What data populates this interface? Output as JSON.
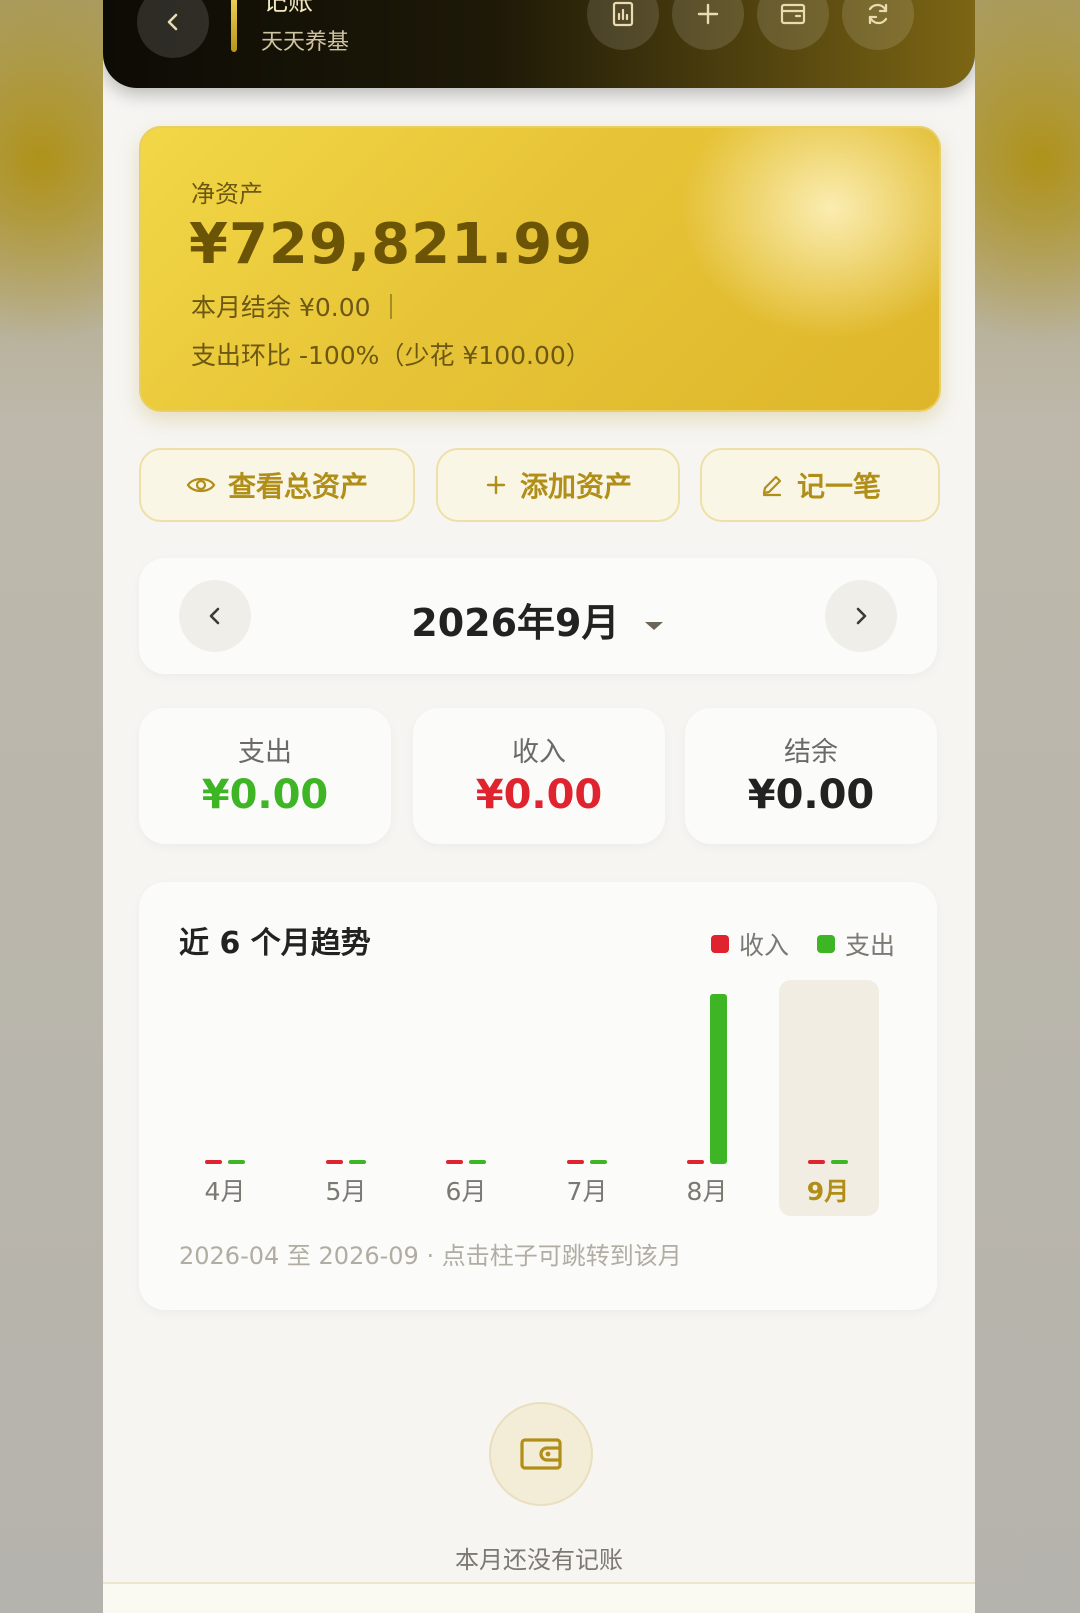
{
  "header": {
    "title": "记账",
    "subtitle": "天天养基"
  },
  "net_assets": {
    "label": "净资产",
    "value": "¥729,821.99",
    "month_balance": "本月结余 ¥0.00 ｜",
    "expense_compare": "支出环比 -100%（少花 ¥100.00）"
  },
  "actions": {
    "view_total": "查看总资产",
    "add_asset": "添加资产",
    "record": "记一笔"
  },
  "month_selector": {
    "current": "2026年9月"
  },
  "stats": {
    "expense": {
      "label": "支出",
      "value": "¥0.00",
      "color": "#3eb524"
    },
    "income": {
      "label": "收入",
      "value": "¥0.00",
      "color": "#e0242f"
    },
    "balance": {
      "label": "结余",
      "value": "¥0.00",
      "color": "#222222"
    }
  },
  "trend": {
    "title": "近 6 个月趋势",
    "legend_income": "收入",
    "legend_expense": "支出",
    "footnote": "2026-04 至 2026-09 · 点击柱子可跳转到该月",
    "selected": "9月"
  },
  "chart_data": {
    "type": "bar",
    "title": "近 6 个月趋势",
    "categories": [
      "4月",
      "5月",
      "6月",
      "7月",
      "8月",
      "9月"
    ],
    "series": [
      {
        "name": "收入",
        "color": "#e0242f",
        "values": [
          0,
          0,
          0,
          0,
          0,
          0
        ]
      },
      {
        "name": "支出",
        "color": "#3eb524",
        "values": [
          0,
          0,
          0,
          0,
          100,
          0
        ]
      }
    ],
    "ylim": [
      0,
      100
    ],
    "grid": false,
    "legend": "top-right"
  },
  "empty_state": {
    "text": "本月还没有记账"
  }
}
